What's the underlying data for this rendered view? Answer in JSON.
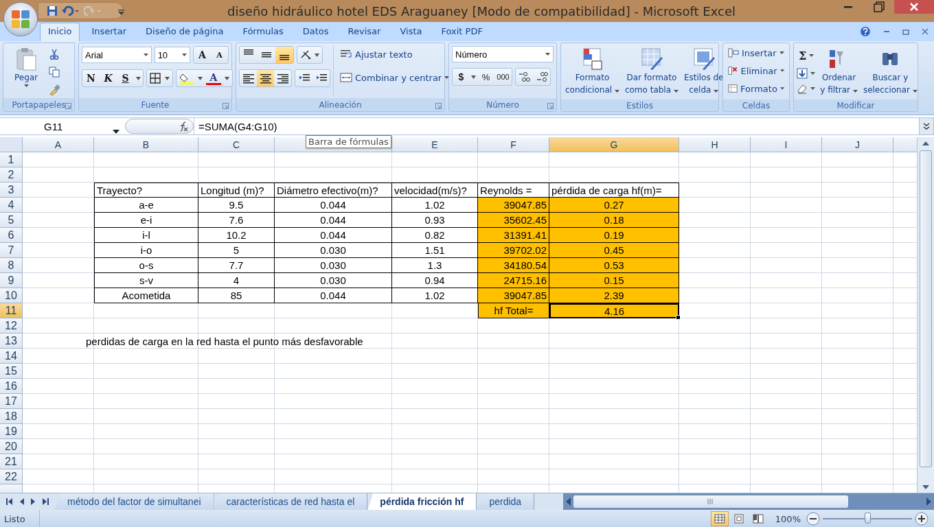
{
  "window": {
    "title": "diseño hidráulico hotel EDS Araguaney  [Modo de compatibilidad] - Microsoft Excel"
  },
  "ribbon": {
    "tabs": [
      {
        "label": "Inicio",
        "selected": true
      },
      {
        "label": "Insertar",
        "selected": false
      },
      {
        "label": "Diseño de página",
        "selected": false
      },
      {
        "label": "Fórmulas",
        "selected": false
      },
      {
        "label": "Datos",
        "selected": false
      },
      {
        "label": "Revisar",
        "selected": false
      },
      {
        "label": "Vista",
        "selected": false
      },
      {
        "label": "Foxit PDF",
        "selected": false
      }
    ],
    "clipboard": {
      "label": "Portapapeles",
      "paste": "Pegar"
    },
    "font": {
      "label": "Fuente",
      "name": "Arial",
      "size": "10",
      "grow": "A",
      "shrink": "A",
      "bold": "N",
      "italic": "K",
      "underline": "S",
      "font_color_button": "A"
    },
    "alignment": {
      "label": "Alineación",
      "vertical": [
        {
          "selected": false
        },
        {
          "selected": false
        },
        {
          "selected": true
        }
      ],
      "horizontal": [
        {
          "selected": false
        },
        {
          "selected": true
        },
        {
          "selected": false
        }
      ],
      "wrap": "Ajustar texto",
      "merge": "Combinar y centrar"
    },
    "number": {
      "label": "Número",
      "format": "Número",
      "currency": "$",
      "percent": "%",
      "thousands": "000"
    },
    "styles": {
      "label": "Estilos",
      "buttons": [
        {
          "lines": [
            "Formato",
            "condicional"
          ]
        },
        {
          "lines": [
            "Dar formato",
            "como tabla"
          ]
        },
        {
          "lines": [
            "Estilos de",
            "celda"
          ]
        }
      ]
    },
    "cells": {
      "label": "Celdas",
      "buttons": [
        "Insertar",
        "Eliminar",
        "Formato"
      ]
    },
    "editing": {
      "label": "Modificar",
      "sum": "Σ",
      "buttons": [
        {
          "lines": [
            "Ordenar",
            "y filtrar"
          ]
        },
        {
          "lines": [
            "Buscar y",
            "seleccionar"
          ]
        }
      ]
    }
  },
  "formula_bar": {
    "name_box": "G11",
    "formula": "=SUMA(G4:G10)",
    "tooltip": "Barra de fórmulas"
  },
  "sheet": {
    "columns": [
      {
        "label": "A",
        "selected": false
      },
      {
        "label": "B",
        "selected": false
      },
      {
        "label": "C",
        "selected": false
      },
      {
        "selected": false
      },
      {
        "label": "E",
        "selected": false
      },
      {
        "label": "F",
        "selected": false
      },
      {
        "label": "G",
        "selected": true
      },
      {
        "label": "H",
        "selected": false
      },
      {
        "label": "I",
        "selected": false
      },
      {
        "label": "J",
        "selected": false
      }
    ],
    "row_numbers": [
      {
        "label": "1",
        "selected": false
      },
      {
        "label": "2",
        "selected": false
      },
      {
        "label": "3",
        "selected": false
      },
      {
        "label": "4",
        "selected": false
      },
      {
        "label": "5",
        "selected": false
      },
      {
        "label": "6",
        "selected": false
      },
      {
        "label": "7",
        "selected": false
      },
      {
        "label": "8",
        "selected": false
      },
      {
        "label": "9",
        "selected": false
      },
      {
        "label": "10",
        "selected": false
      },
      {
        "label": "11",
        "selected": true
      },
      {
        "label": "12",
        "selected": false
      },
      {
        "label": "13",
        "selected": false
      },
      {
        "label": "14",
        "selected": false
      },
      {
        "label": "15",
        "selected": false
      },
      {
        "label": "16",
        "selected": false
      },
      {
        "label": "17",
        "selected": false
      },
      {
        "label": "18",
        "selected": false
      },
      {
        "label": "19",
        "selected": false
      },
      {
        "label": "20",
        "selected": false
      },
      {
        "label": "21",
        "selected": false
      },
      {
        "label": "22",
        "selected": false
      }
    ],
    "table": {
      "header": [
        "Trayecto?",
        "Longitud (m)?",
        "Diámetro efectivo(m)?",
        "velocidad(m/s)?",
        "Reynolds =",
        "pérdida de carga hf(m)="
      ],
      "rows": [
        {
          "cells": [
            {
              "text": "a-e",
              "highlighted": false
            },
            {
              "text": "9.5",
              "highlighted": false
            },
            {
              "text": "0.044",
              "highlighted": false
            },
            {
              "text": "1.02",
              "highlighted": false
            },
            {
              "text": "39047.85",
              "highlighted": true
            },
            {
              "text": "0.27",
              "highlighted": true
            }
          ]
        },
        {
          "cells": [
            {
              "text": "e-i",
              "highlighted": false
            },
            {
              "text": "7.6",
              "highlighted": false
            },
            {
              "text": "0.044",
              "highlighted": false
            },
            {
              "text": "0.93",
              "highlighted": false
            },
            {
              "text": "35602.45",
              "highlighted": true
            },
            {
              "text": "0.18",
              "highlighted": true
            }
          ]
        },
        {
          "cells": [
            {
              "text": "i-l",
              "highlighted": false
            },
            {
              "text": "10.2",
              "highlighted": false
            },
            {
              "text": "0.044",
              "highlighted": false
            },
            {
              "text": "0.82",
              "highlighted": false
            },
            {
              "text": "31391.41",
              "highlighted": true
            },
            {
              "text": "0.19",
              "highlighted": true
            }
          ]
        },
        {
          "cells": [
            {
              "text": "i-o",
              "highlighted": false
            },
            {
              "text": "5",
              "highlighted": false
            },
            {
              "text": "0.030",
              "highlighted": false
            },
            {
              "text": "1.51",
              "highlighted": false
            },
            {
              "text": "39702.02",
              "highlighted": true
            },
            {
              "text": "0.45",
              "highlighted": true
            }
          ]
        },
        {
          "cells": [
            {
              "text": "o-s",
              "highlighted": false
            },
            {
              "text": "7.7",
              "highlighted": false
            },
            {
              "text": "0.030",
              "highlighted": false
            },
            {
              "text": "1.3",
              "highlighted": false
            },
            {
              "text": "34180.54",
              "highlighted": true
            },
            {
              "text": "0.53",
              "highlighted": true
            }
          ]
        },
        {
          "cells": [
            {
              "text": "s-v",
              "highlighted": false
            },
            {
              "text": "4",
              "highlighted": false
            },
            {
              "text": "0.030",
              "highlighted": false
            },
            {
              "text": "0.94",
              "highlighted": false
            },
            {
              "text": "24715.16",
              "highlighted": true
            },
            {
              "text": "0.15",
              "highlighted": true
            }
          ]
        },
        {
          "cells": [
            {
              "text": "Acometida",
              "highlighted": false
            },
            {
              "text": "85",
              "highlighted": false
            },
            {
              "text": "0.044",
              "highlighted": false
            },
            {
              "text": "1.02",
              "highlighted": false
            },
            {
              "text": "39047.85",
              "highlighted": true
            },
            {
              "text": "2.39",
              "highlighted": true
            }
          ]
        }
      ],
      "total": {
        "label": "hf Total=",
        "value": "4.16",
        "highlighted": true,
        "selected": true
      }
    },
    "note": "perdidas de carga en la red hasta el punto más desfavorable"
  },
  "sheet_tabs": [
    {
      "label": "método del factor de simultanei",
      "selected": false
    },
    {
      "label": "características de red hasta el",
      "selected": false
    },
    {
      "label": "pérdida fricción hf",
      "selected": true
    },
    {
      "label": "perdida",
      "selected": false
    }
  ],
  "status_bar": {
    "status": "Listo",
    "views": [
      {
        "selected": true
      },
      {
        "selected": false
      },
      {
        "selected": false
      }
    ],
    "zoom": "100%",
    "zoom_slider": {
      "level": 0.5
    }
  }
}
